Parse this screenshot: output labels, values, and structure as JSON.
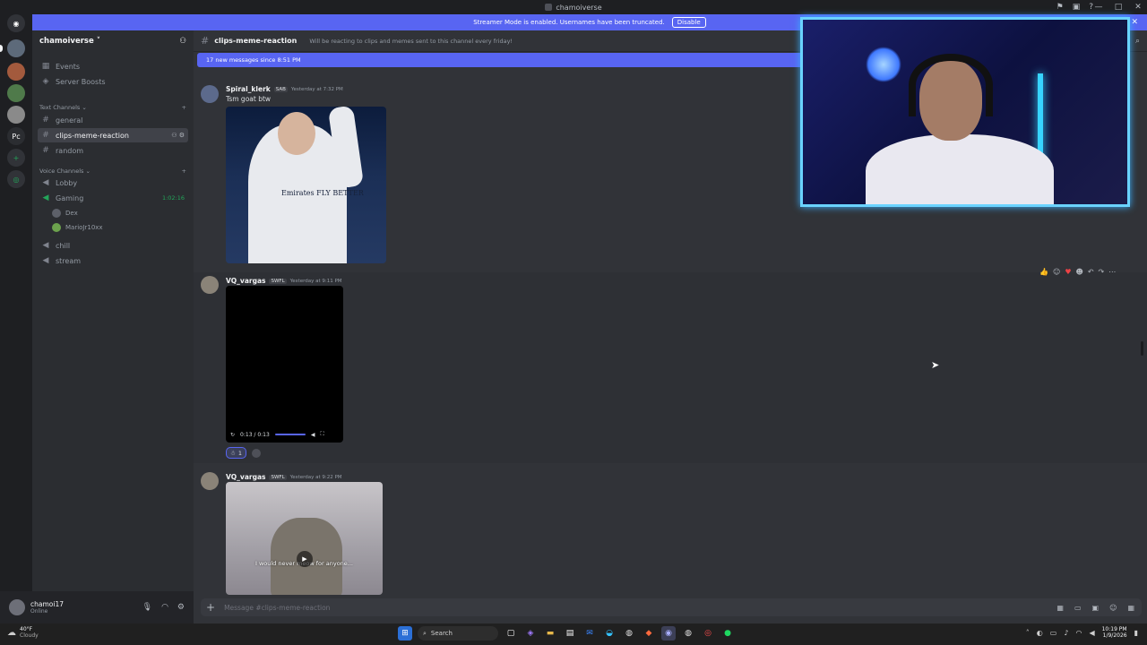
{
  "window": {
    "title": "chamoiverse",
    "controls": [
      "—",
      "□",
      "✕"
    ],
    "toolbar_icons": [
      "flag-icon",
      "monitor-icon",
      "help-icon"
    ]
  },
  "banner": {
    "text": "Streamer Mode is enabled. Usernames have been truncated.",
    "button": "Disable"
  },
  "rail": {
    "servers": [
      "discord-home",
      "server-1",
      "server-2",
      "server-3",
      "Pc",
      "add-server",
      "explore"
    ]
  },
  "sidebar": {
    "guild_name": "chamoiverse ˅",
    "items": [
      {
        "icon": "▦",
        "label": "Events"
      },
      {
        "icon": "◈",
        "label": "Server Boosts"
      }
    ],
    "text_category": "Text Channels ⌄",
    "text_channels": [
      "general",
      "clips-meme-reaction",
      "random"
    ],
    "voice_category": "Voice Channels ⌄",
    "voice_channels": [
      {
        "label": "Lobby",
        "timer": ""
      },
      {
        "label": "Gaming",
        "timer": "1:02:16"
      },
      {
        "label": "chill",
        "timer": ""
      },
      {
        "label": "stream",
        "timer": ""
      }
    ],
    "voice_users": [
      "Dex",
      "MarioJr10xx"
    ]
  },
  "user": {
    "name": "chamoi17",
    "status": "Online"
  },
  "channel": {
    "name": "clips-meme-reaction",
    "topic": "Will be reacting to clips and memes sent to this channel every friday!",
    "new_messages": "17 new messages since 8:51 PM"
  },
  "messages": [
    {
      "author": "Spiral_klerk",
      "tag": "SAB",
      "timestamp": "Yesterday at 7:32 PM",
      "text": "Tsm goat btw",
      "image_logo": "Emirates FLY BETTER"
    },
    {
      "author": "VQ_vargas",
      "tag": "SWFL",
      "timestamp": "Yesterday at 9:11 PM",
      "video_time": "0:13 / 0:13",
      "reaction_count": "1"
    },
    {
      "author": "VQ_vargas",
      "tag": "SWFL",
      "timestamp": "Yesterday at 9:22 PM",
      "caption": "I would never meow for anyone..."
    }
  ],
  "composer": {
    "placeholder": "Message #clips-meme-reaction"
  },
  "taskbar": {
    "weather_temp": "40°F",
    "weather_desc": "Cloudy",
    "search": "Search",
    "time": "10:19 PM",
    "date": "1/9/2026"
  }
}
